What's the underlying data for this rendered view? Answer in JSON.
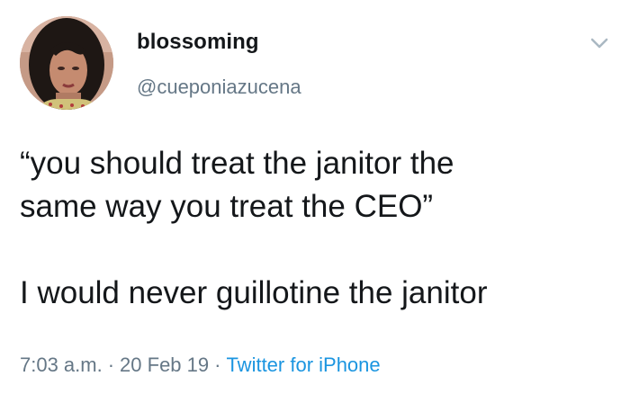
{
  "tweet": {
    "author": {
      "display_name": "blossoming",
      "handle": "@cueponiazucena",
      "avatar_icon": "profile-photo"
    },
    "menu_icon": "chevron-down-icon",
    "text_lines": [
      "“you should treat the janitor the",
      "same way you treat the CEO”",
      "I would never guillotine the janitor"
    ],
    "time": "7:03 a.m.",
    "date": "20 Feb 19",
    "separator": "·",
    "source": "Twitter for iPhone"
  },
  "colors": {
    "text": "#14171a",
    "secondary_text": "#657786",
    "link": "#1b95e0",
    "background": "#ffffff"
  }
}
